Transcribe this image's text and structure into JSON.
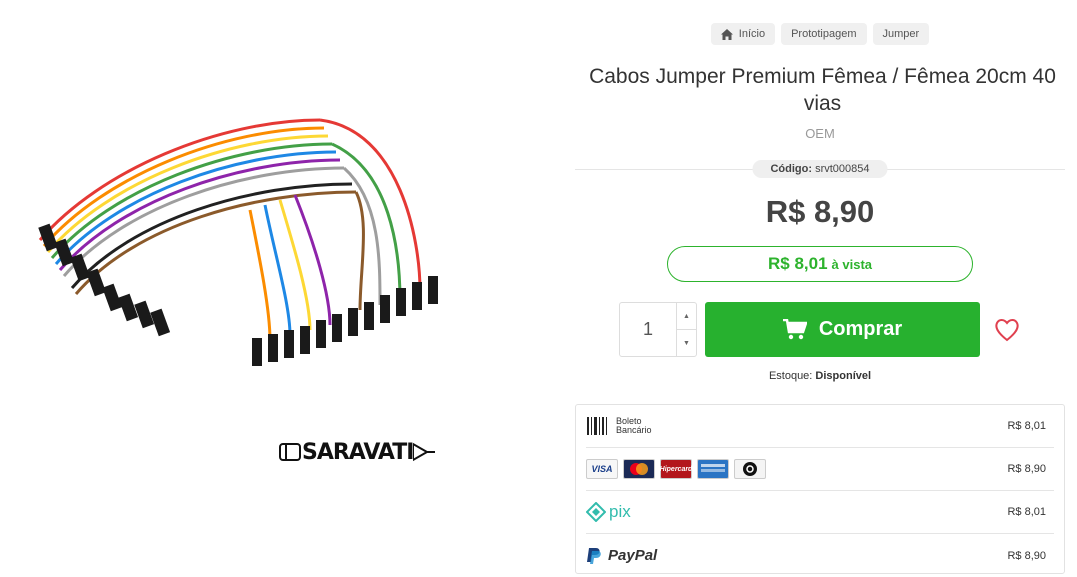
{
  "breadcrumb": [
    {
      "label": "Início",
      "icon": "home-icon"
    },
    {
      "label": "Prototipagem"
    },
    {
      "label": "Jumper"
    }
  ],
  "product": {
    "title": "Cabos Jumper Premium Fêmea / Fêmea 20cm 40 vias",
    "brand": "OEM",
    "code_label": "Código:",
    "code_value": "srvt000854",
    "price": "R$ 8,90",
    "cash_price": "R$ 8,01",
    "cash_label": "à vista",
    "brand_logo_text": "SARAVATI"
  },
  "purchase": {
    "quantity": "1",
    "buy_label": "Comprar",
    "stock_label": "Estoque:",
    "stock_value": "Disponível"
  },
  "payments": [
    {
      "method": "Boleto Bancário",
      "value": "R$ 8,01"
    },
    {
      "method": "Cartões",
      "brands": [
        "VISA",
        "Hipercard"
      ],
      "value": "R$ 8,90"
    },
    {
      "method": "pix",
      "value": "R$ 8,01"
    },
    {
      "method": "PayPal",
      "value": "R$ 8,90"
    }
  ],
  "colors": {
    "accent_green": "#27b12f",
    "cash_green": "#2db32d",
    "wishlist_red": "#e0404f"
  }
}
